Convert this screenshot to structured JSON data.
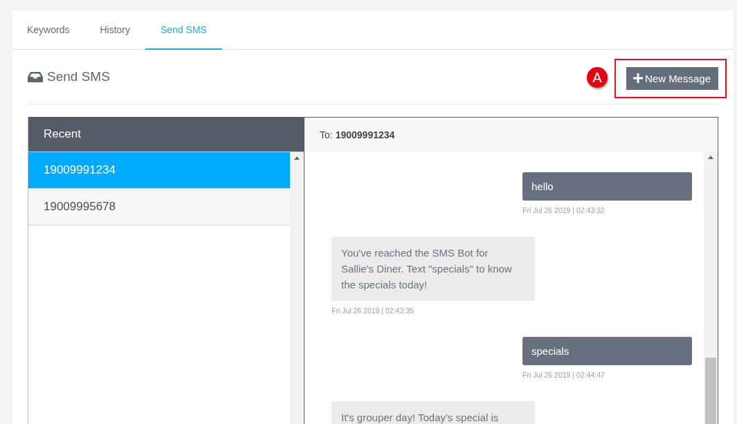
{
  "tabs": [
    {
      "label": "Keywords",
      "selected": false
    },
    {
      "label": "History",
      "selected": false
    },
    {
      "label": "Send SMS",
      "selected": true
    }
  ],
  "page_title": "Send SMS",
  "callout": "A",
  "new_message_button": {
    "label": "New Message"
  },
  "recent": {
    "title": "Recent",
    "items": [
      {
        "number": "19009991234",
        "selected": true
      },
      {
        "number": "19009995678",
        "selected": false
      }
    ]
  },
  "conversation": {
    "to_label": "To:",
    "to_number": "19009991234",
    "messages": [
      {
        "kind": "sent",
        "text": "hello",
        "timestamp": "Fri Jul 26 2019 | 02:43:32"
      },
      {
        "kind": "received",
        "text": "You've reached the SMS Bot for Sallie's Diner. Text \"specials\" to know the specials today!",
        "timestamp": "Fri Jul 26 2019 | 02:43:35"
      },
      {
        "kind": "sent",
        "text": "specials",
        "timestamp": "Fri Jul 26 2019 | 02:44:47"
      },
      {
        "kind": "received",
        "text": "It's grouper day! Today's special is"
      }
    ]
  }
}
